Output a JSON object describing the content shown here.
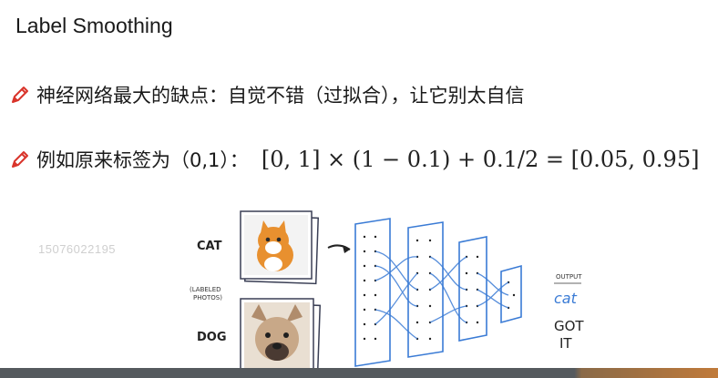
{
  "slide": {
    "title": "Label Smoothing",
    "bullet1": "神经网络最大的缺点：自觉不错（过拟合），让它别太自信",
    "bullet2_prefix": "例如原来标签为（0,1）：",
    "formula": "[0, 1] × (1 − 0.1) + 0.1/2 = [0.05, 0.95]"
  },
  "watermark": "15076022195",
  "illustration": {
    "cat_label": "CAT",
    "labeled_photos_line1": "(LABELED",
    "labeled_photos_line2": "PHOTOS)",
    "dog_label": "DOG",
    "output_label": "OUTPUT",
    "output_value": "cat",
    "got_line1": "GOT",
    "got_line2": "IT"
  },
  "colors": {
    "pencil_red": "#d9342b",
    "network_blue": "#3a7bd5",
    "cat_orange": "#e8902f",
    "bottom_bar": "#555a5e",
    "bottom_bar_accent": "#c07a3a"
  },
  "icons": [
    "pencil-icon"
  ]
}
